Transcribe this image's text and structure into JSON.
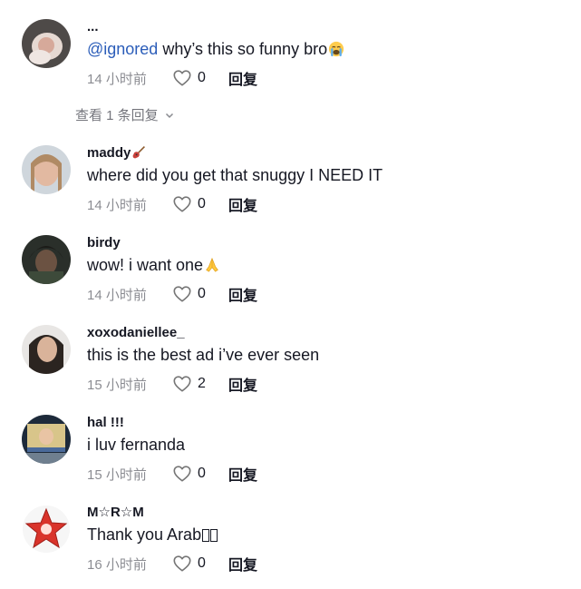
{
  "comments": [
    {
      "username": "...",
      "mention": "@ignored",
      "text": " why’s this so funny bro",
      "emoji": "loudly-crying-face",
      "time": "14 小时前",
      "likes": "0",
      "reply": "回复"
    },
    {
      "username": "maddy",
      "username_emoji": "guitar",
      "text": "where did you get that snuggy I NEED IT",
      "time": "14 小时前",
      "likes": "0",
      "reply": "回复"
    },
    {
      "username": "birdy",
      "text": "wow! i want one",
      "emoji": "folded-hands",
      "time": "14 小时前",
      "likes": "0",
      "reply": "回复"
    },
    {
      "username": "xoxodaniellee_",
      "text": "this is the best ad i’ve ever seen",
      "time": "15 小时前",
      "likes": "2",
      "reply": "回复"
    },
    {
      "username": "hal !!!",
      "text": "i luv fernanda",
      "time": "15 小时前",
      "likes": "0",
      "reply": "回复"
    },
    {
      "username": "M☆R☆M",
      "text": "Thank you Arab",
      "time": "16 小时前",
      "likes": "0",
      "reply": "回复"
    }
  ],
  "view_replies": "查看 1 条回复",
  "icons": {
    "like": "heart-outline-icon",
    "expand": "chevron-down-icon"
  },
  "colors": {
    "mention": "#2b5db9",
    "text": "#161823",
    "meta": "#8a8b91"
  }
}
